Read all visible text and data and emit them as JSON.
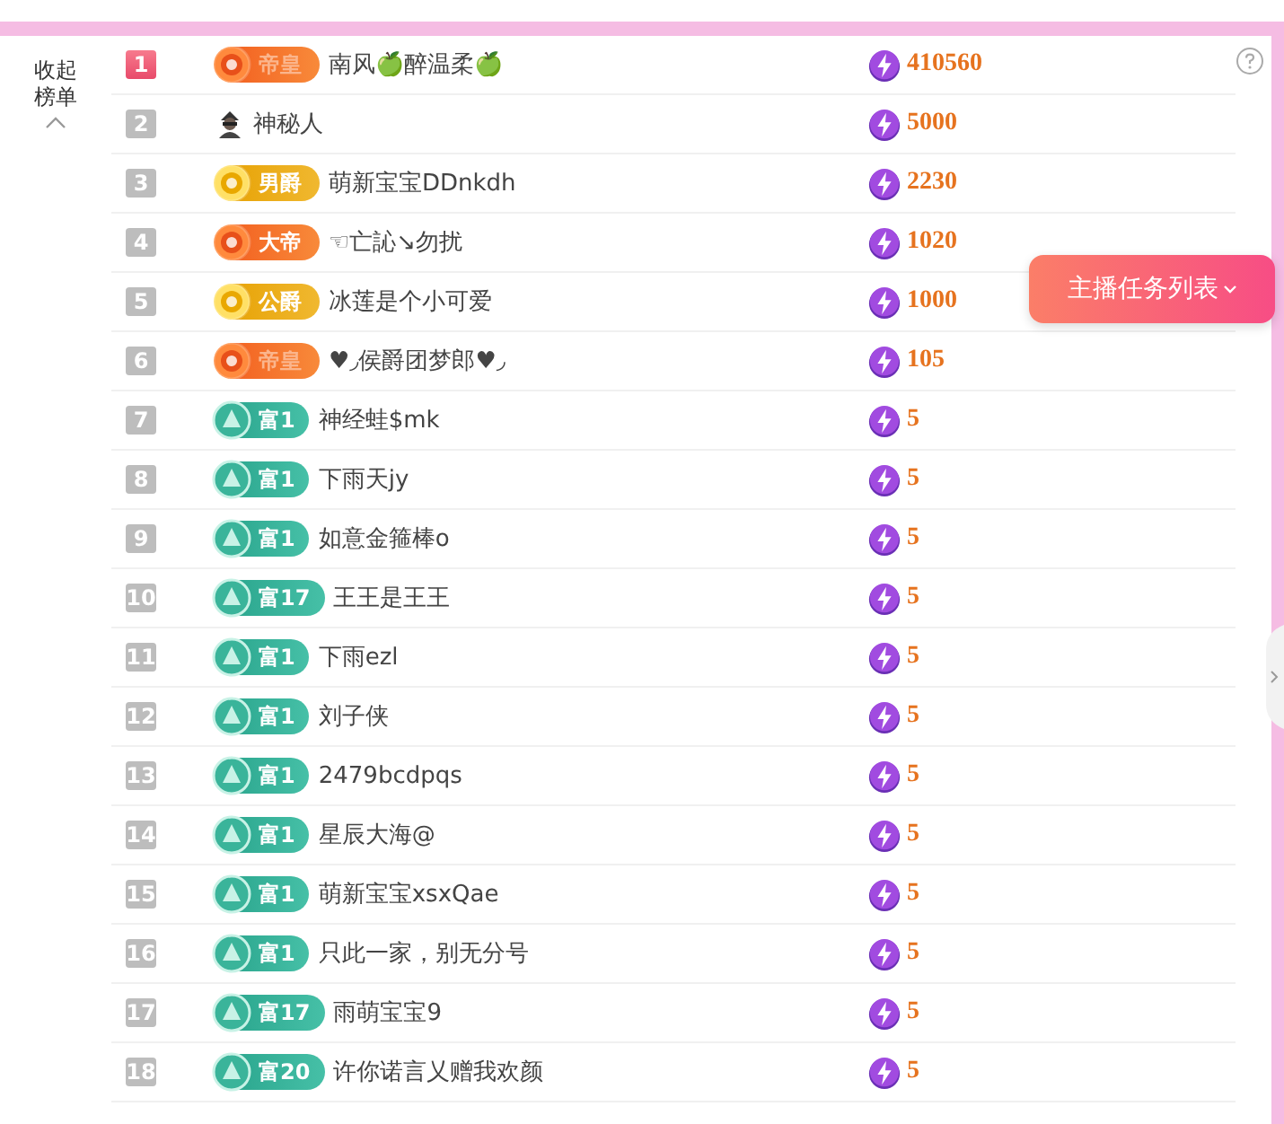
{
  "collapse_label": "收起榜单",
  "rows": [
    {
      "rank": "1",
      "highlight": true,
      "kind": "orange",
      "badge": "帝皇",
      "faded": true,
      "name": "南风🍏醉温柔🍏",
      "value": "410560"
    },
    {
      "rank": "2",
      "highlight": false,
      "kind": "mystery",
      "name": "神秘人",
      "value": "5000"
    },
    {
      "rank": "3",
      "highlight": false,
      "kind": "gold",
      "badge": "男爵",
      "faded": false,
      "name": "萌新宝宝DDnkdh",
      "value": "2230"
    },
    {
      "rank": "4",
      "highlight": false,
      "kind": "orange",
      "badge": "大帝",
      "faded": false,
      "name": "☜亡訫↘勿扰",
      "value": "1020"
    },
    {
      "rank": "5",
      "highlight": false,
      "kind": "gold",
      "badge": "公爵",
      "faded": false,
      "name": "冰莲是个小可爱",
      "value": "1000"
    },
    {
      "rank": "6",
      "highlight": false,
      "kind": "orange",
      "badge": "帝皇",
      "faded": true,
      "name": "♥◞侯爵团梦郎♥◞",
      "value": "105"
    },
    {
      "rank": "7",
      "highlight": false,
      "kind": "wealth",
      "badge": "富1",
      "name": "神经蛙$mk",
      "value": "5"
    },
    {
      "rank": "8",
      "highlight": false,
      "kind": "wealth",
      "badge": "富1",
      "name": "下雨天jy",
      "value": "5"
    },
    {
      "rank": "9",
      "highlight": false,
      "kind": "wealth",
      "badge": "富1",
      "name": "如意金箍棒o",
      "value": "5"
    },
    {
      "rank": "10",
      "highlight": false,
      "kind": "wealth",
      "badge": "富17",
      "name": "王王是王王",
      "value": "5"
    },
    {
      "rank": "11",
      "highlight": false,
      "kind": "wealth",
      "badge": "富1",
      "name": "下雨ezl",
      "value": "5"
    },
    {
      "rank": "12",
      "highlight": false,
      "kind": "wealth",
      "badge": "富1",
      "name": "刘子侠",
      "value": "5"
    },
    {
      "rank": "13",
      "highlight": false,
      "kind": "wealth",
      "badge": "富1",
      "name": "2479bcdpqs",
      "value": "5"
    },
    {
      "rank": "14",
      "highlight": false,
      "kind": "wealth",
      "badge": "富1",
      "name": "星辰大海@",
      "value": "5"
    },
    {
      "rank": "15",
      "highlight": false,
      "kind": "wealth",
      "badge": "富1",
      "name": "萌新宝宝xsxQae",
      "value": "5"
    },
    {
      "rank": "16",
      "highlight": false,
      "kind": "wealth",
      "badge": "富1",
      "name": "只此一家，别无分号",
      "value": "5"
    },
    {
      "rank": "17",
      "highlight": false,
      "kind": "wealth",
      "badge": "富17",
      "name": "雨萌宝宝9",
      "value": "5"
    },
    {
      "rank": "18",
      "highlight": false,
      "kind": "wealth",
      "badge": "富20",
      "name": "许你诺言乂赠我欢颜",
      "value": "5"
    }
  ],
  "task_button": "主播任务列表"
}
